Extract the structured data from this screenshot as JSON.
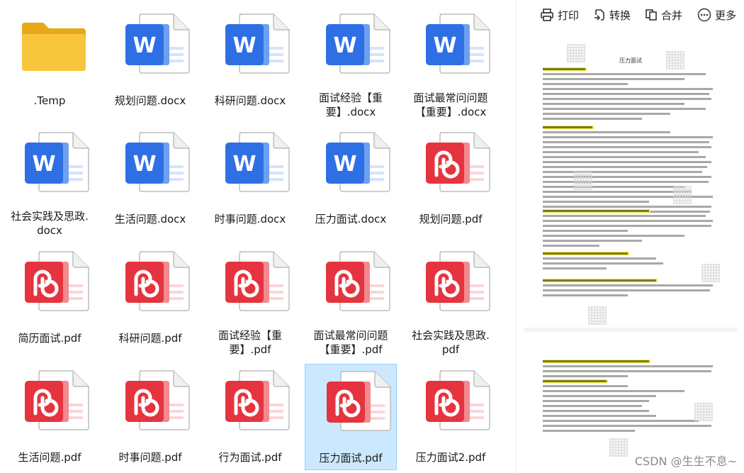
{
  "files": [
    {
      "name": ".Temp",
      "type": "folder"
    },
    {
      "name": "规划问题.docx",
      "type": "word"
    },
    {
      "name": "科研问题.docx",
      "type": "word"
    },
    {
      "name": "面试经验【重\n要】.docx",
      "type": "word"
    },
    {
      "name": "面试最常问问题\n【重要】.docx",
      "type": "word"
    },
    {
      "name": "社会实践及思政.\ndocx",
      "type": "word"
    },
    {
      "name": "生活问题.docx",
      "type": "word"
    },
    {
      "name": "时事问题.docx",
      "type": "word"
    },
    {
      "name": "压力面试.docx",
      "type": "word"
    },
    {
      "name": "规划问题.pdf",
      "type": "pdf"
    },
    {
      "name": "简历面试.pdf",
      "type": "pdf"
    },
    {
      "name": "科研问题.pdf",
      "type": "pdf"
    },
    {
      "name": "面试经验【重\n要】.pdf",
      "type": "pdf"
    },
    {
      "name": "面试最常问问题\n【重要】.pdf",
      "type": "pdf"
    },
    {
      "name": "社会实践及思政.\npdf",
      "type": "pdf"
    },
    {
      "name": "生活问题.pdf",
      "type": "pdf"
    },
    {
      "name": "时事问题.pdf",
      "type": "pdf"
    },
    {
      "name": "行为面试.pdf",
      "type": "pdf"
    },
    {
      "name": "压力面试.pdf",
      "type": "pdf",
      "selected": true
    },
    {
      "name": "压力面试2.pdf",
      "type": "pdf"
    }
  ],
  "toolbar": {
    "print": "打印",
    "convert": "转换",
    "merge": "合并",
    "more": "更多"
  },
  "preview": {
    "page_title": "压力面试"
  },
  "watermark": "CSDN @生生不息~",
  "colors": {
    "word_blue": "#2f6fe4",
    "pdf_red": "#e5343f",
    "folder_yellow": "#f8c63d",
    "selection": "#cce8ff"
  }
}
